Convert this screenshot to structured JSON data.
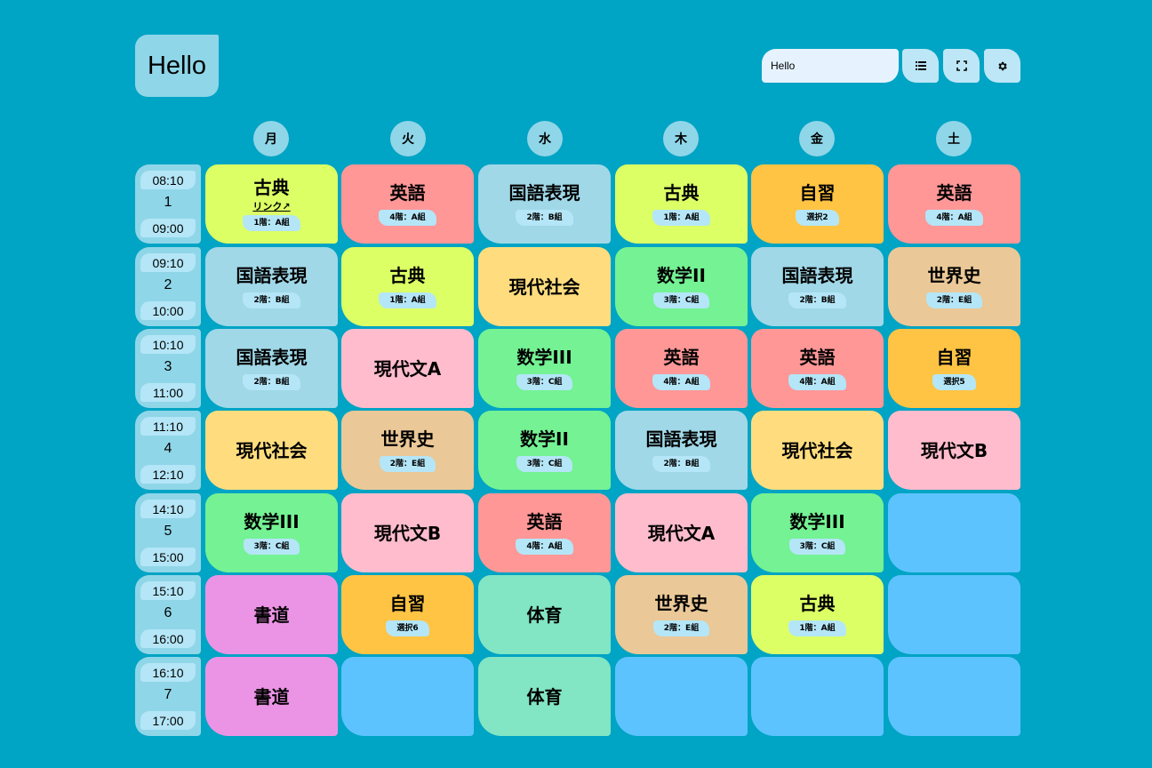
{
  "header": {
    "title": "Hello",
    "search_value": "Hello",
    "buttons": [
      {
        "name": "list-view-button",
        "icon": "list-icon"
      },
      {
        "name": "fullscreen-button",
        "icon": "fullscreen-icon"
      },
      {
        "name": "settings-button",
        "icon": "gear-icon"
      }
    ]
  },
  "colors": {
    "background": "#00a4c4",
    "empty_cell": "#5cc3fe",
    "kotenn": "#dcff65",
    "eigo": "#ff9797",
    "kokugo_hyogen": "#a0d8e8",
    "jishu": "#ffc444",
    "sugaku": "#74f294",
    "gendai_shakai": "#ffdd7e",
    "sekaishi": "#eac897",
    "gendaibun": "#ffbccd",
    "shodo": "#eb94e6",
    "taiiku": "#82e5c4"
  },
  "days": [
    "月",
    "火",
    "水",
    "木",
    "金",
    "土"
  ],
  "periods": [
    {
      "num": "1",
      "start": "08:10",
      "end": "09:00"
    },
    {
      "num": "2",
      "start": "09:10",
      "end": "10:00"
    },
    {
      "num": "3",
      "start": "10:10",
      "end": "11:00"
    },
    {
      "num": "4",
      "start": "11:10",
      "end": "12:10"
    },
    {
      "num": "5",
      "start": "14:10",
      "end": "15:00"
    },
    {
      "num": "6",
      "start": "15:10",
      "end": "16:00"
    },
    {
      "num": "7",
      "start": "16:10",
      "end": "17:00"
    }
  ],
  "timetable": [
    [
      {
        "subject": "古典",
        "room": "1階：A組",
        "link": "リンク↗",
        "color": "#dcff65"
      },
      {
        "subject": "英語",
        "room": "4階：A組",
        "color": "#ff9797"
      },
      {
        "subject": "国語表現",
        "room": "2階：B組",
        "color": "#a0d8e8"
      },
      {
        "subject": "古典",
        "room": "1階：A組",
        "color": "#dcff65"
      },
      {
        "subject": "自習",
        "room": "選択2",
        "color": "#ffc444"
      },
      {
        "subject": "英語",
        "room": "4階：A組",
        "color": "#ff9797"
      }
    ],
    [
      {
        "subject": "国語表現",
        "room": "2階：B組",
        "color": "#a0d8e8"
      },
      {
        "subject": "古典",
        "room": "1階：A組",
        "color": "#dcff65"
      },
      {
        "subject": "現代社会",
        "color": "#ffdd7e"
      },
      {
        "subject": "数学II",
        "room": "3階：C組",
        "color": "#74f294"
      },
      {
        "subject": "国語表現",
        "room": "2階：B組",
        "color": "#a0d8e8"
      },
      {
        "subject": "世界史",
        "room": "2階：E組",
        "color": "#eac897"
      }
    ],
    [
      {
        "subject": "国語表現",
        "room": "2階：B組",
        "color": "#a0d8e8"
      },
      {
        "subject": "現代文A",
        "color": "#ffbccd"
      },
      {
        "subject": "数学III",
        "room": "3階：C組",
        "color": "#74f294"
      },
      {
        "subject": "英語",
        "room": "4階：A組",
        "color": "#ff9797"
      },
      {
        "subject": "英語",
        "room": "4階：A組",
        "color": "#ff9797"
      },
      {
        "subject": "自習",
        "room": "選択5",
        "color": "#ffc444"
      }
    ],
    [
      {
        "subject": "現代社会",
        "color": "#ffdd7e"
      },
      {
        "subject": "世界史",
        "room": "2階：E組",
        "color": "#eac897"
      },
      {
        "subject": "数学II",
        "room": "3階：C組",
        "color": "#74f294"
      },
      {
        "subject": "国語表現",
        "room": "2階：B組",
        "color": "#a0d8e8"
      },
      {
        "subject": "現代社会",
        "color": "#ffdd7e"
      },
      {
        "subject": "現代文B",
        "color": "#ffbccd"
      }
    ],
    [
      {
        "subject": "数学III",
        "room": "3階：C組",
        "color": "#74f294"
      },
      {
        "subject": "現代文B",
        "color": "#ffbccd"
      },
      {
        "subject": "英語",
        "room": "4階：A組",
        "color": "#ff9797"
      },
      {
        "subject": "現代文A",
        "color": "#ffbccd"
      },
      {
        "subject": "数学III",
        "room": "3階：C組",
        "color": "#74f294"
      },
      null
    ],
    [
      {
        "subject": "書道",
        "color": "#eb94e6"
      },
      {
        "subject": "自習",
        "room": "選択6",
        "color": "#ffc444"
      },
      {
        "subject": "体育",
        "color": "#82e5c4"
      },
      {
        "subject": "世界史",
        "room": "2階：E組",
        "color": "#eac897"
      },
      {
        "subject": "古典",
        "room": "1階：A組",
        "color": "#dcff65"
      },
      null
    ],
    [
      {
        "subject": "書道",
        "color": "#eb94e6"
      },
      null,
      {
        "subject": "体育",
        "color": "#82e5c4"
      },
      null,
      null,
      null
    ]
  ]
}
